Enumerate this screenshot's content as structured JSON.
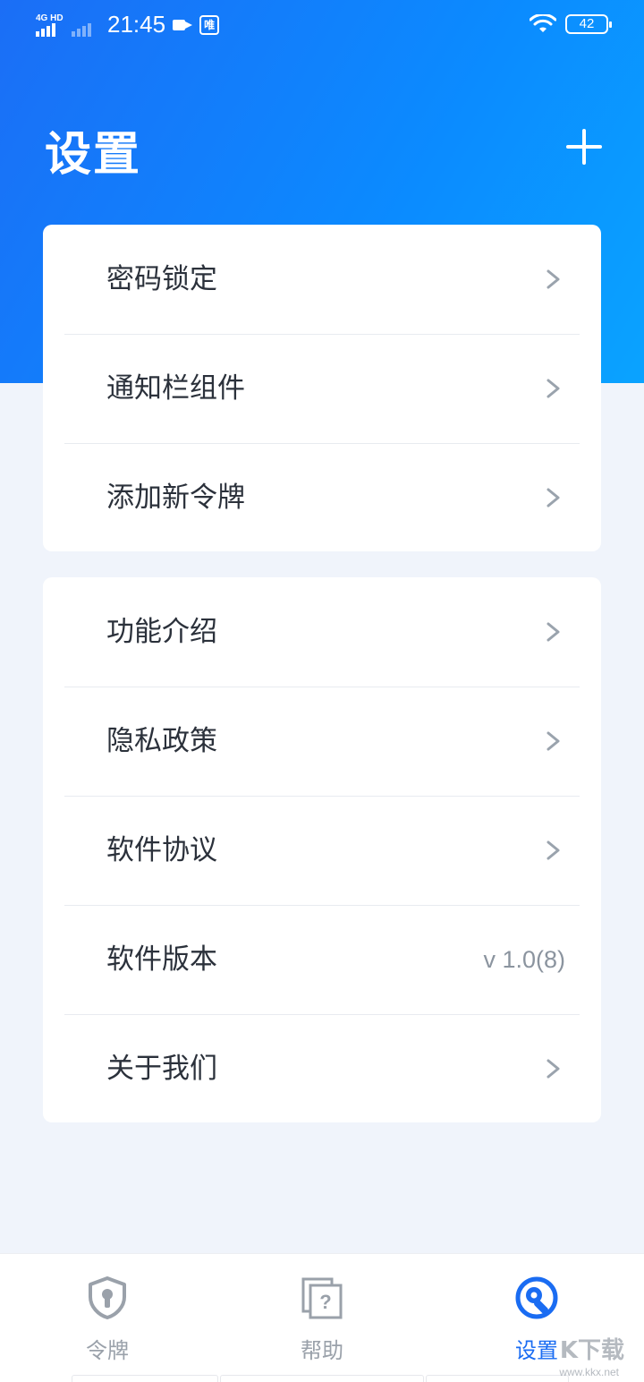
{
  "status_bar": {
    "network_type": "4G HD",
    "time": "21:45",
    "sim_label": "唯",
    "battery_level": "42",
    "icons": [
      "signal-icon",
      "signal-icon",
      "video-camera-icon",
      "sim-icon",
      "wifi-icon",
      "battery-icon"
    ]
  },
  "header": {
    "title": "设置",
    "add_icon": "plus-icon"
  },
  "settings_group_1": {
    "items": [
      {
        "label": "密码锁定",
        "icon": "chevron-right-icon"
      },
      {
        "label": "通知栏组件",
        "icon": "chevron-right-icon"
      },
      {
        "label": "添加新令牌",
        "icon": "chevron-right-icon"
      }
    ]
  },
  "settings_group_2": {
    "items": [
      {
        "label": "功能介绍",
        "icon": "chevron-right-icon"
      },
      {
        "label": "隐私政策",
        "icon": "chevron-right-icon"
      },
      {
        "label": "软件协议",
        "icon": "chevron-right-icon"
      },
      {
        "label": "软件版本",
        "value": "v 1.0(8)"
      },
      {
        "label": "关于我们",
        "icon": "chevron-right-icon"
      }
    ]
  },
  "tab_bar": {
    "tabs": [
      {
        "label": "令牌",
        "icon": "shield-keyhole-icon",
        "active": false
      },
      {
        "label": "帮助",
        "icon": "help-pages-icon",
        "active": false
      },
      {
        "label": "设置",
        "icon": "settings-wrench-icon",
        "active": true
      }
    ]
  },
  "watermark": {
    "text": "K下载",
    "sub": "www.kkx.net"
  },
  "colors": {
    "accent": "#1a6cf2",
    "header_gradient_start": "#1b6ef6",
    "header_gradient_end": "#0aa3ff",
    "background": "#f0f4fb",
    "inactive_tab": "#9aa1aa"
  }
}
